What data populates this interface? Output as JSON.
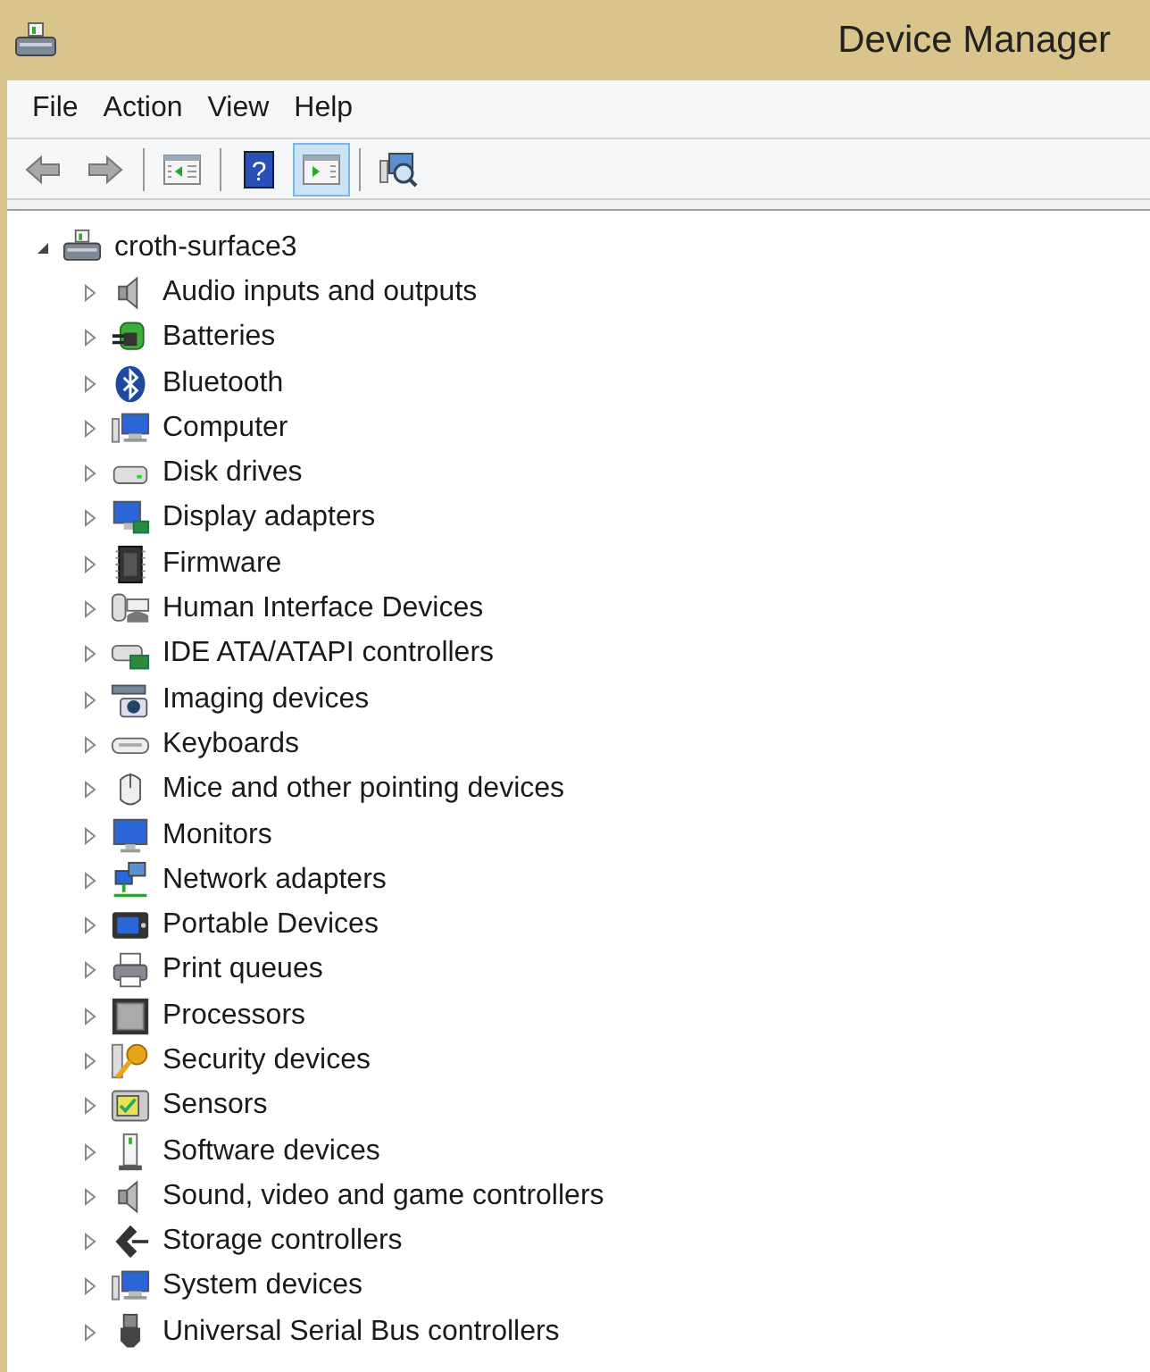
{
  "window": {
    "title": "Device Manager"
  },
  "menu": [
    "File",
    "Action",
    "View",
    "Help"
  ],
  "toolbar": [
    [
      {
        "kind": "back",
        "pressed": false
      },
      {
        "kind": "forward",
        "pressed": false
      }
    ],
    [
      {
        "kind": "console-tree",
        "pressed": false
      }
    ],
    [
      {
        "kind": "help",
        "glyph": "?",
        "pressed": false
      },
      {
        "kind": "action-pane",
        "pressed": true
      }
    ],
    [
      {
        "kind": "scan",
        "pressed": false
      }
    ]
  ],
  "tree": {
    "label": "croth-surface3",
    "kind": "host",
    "expanded": true,
    "children": [
      {
        "label": "Audio inputs and outputs",
        "kind": "speaker",
        "expanded": false
      },
      {
        "label": "Batteries",
        "kind": "battery",
        "expanded": false
      },
      {
        "label": "Bluetooth",
        "kind": "bluetooth",
        "expanded": false
      },
      {
        "label": "Computer",
        "kind": "computer",
        "expanded": false
      },
      {
        "label": "Disk drives",
        "kind": "disk",
        "expanded": false
      },
      {
        "label": "Display adapters",
        "kind": "display",
        "expanded": false
      },
      {
        "label": "Firmware",
        "kind": "chip",
        "expanded": false
      },
      {
        "label": "Human Interface Devices",
        "kind": "hid",
        "expanded": false
      },
      {
        "label": "IDE ATA/ATAPI controllers",
        "kind": "ide",
        "expanded": false
      },
      {
        "label": "Imaging devices",
        "kind": "camera",
        "expanded": false
      },
      {
        "label": "Keyboards",
        "kind": "keyboard",
        "expanded": false
      },
      {
        "label": "Mice and other pointing devices",
        "kind": "mouse",
        "expanded": false
      },
      {
        "label": "Monitors",
        "kind": "monitor",
        "expanded": false
      },
      {
        "label": "Network adapters",
        "kind": "network",
        "expanded": false
      },
      {
        "label": "Portable Devices",
        "kind": "portable",
        "expanded": false
      },
      {
        "label": "Print queues",
        "kind": "printer",
        "expanded": false
      },
      {
        "label": "Processors",
        "kind": "processor",
        "expanded": false
      },
      {
        "label": "Security devices",
        "kind": "key",
        "expanded": false
      },
      {
        "label": "Sensors",
        "kind": "sensor",
        "expanded": false
      },
      {
        "label": "Software devices",
        "kind": "software",
        "expanded": false
      },
      {
        "label": "Sound, video and game controllers",
        "kind": "speaker",
        "expanded": false
      },
      {
        "label": "Storage controllers",
        "kind": "storage",
        "expanded": false
      },
      {
        "label": "System devices",
        "kind": "computer",
        "expanded": false
      },
      {
        "label": "Universal Serial Bus controllers",
        "kind": "usb",
        "expanded": false
      }
    ]
  }
}
